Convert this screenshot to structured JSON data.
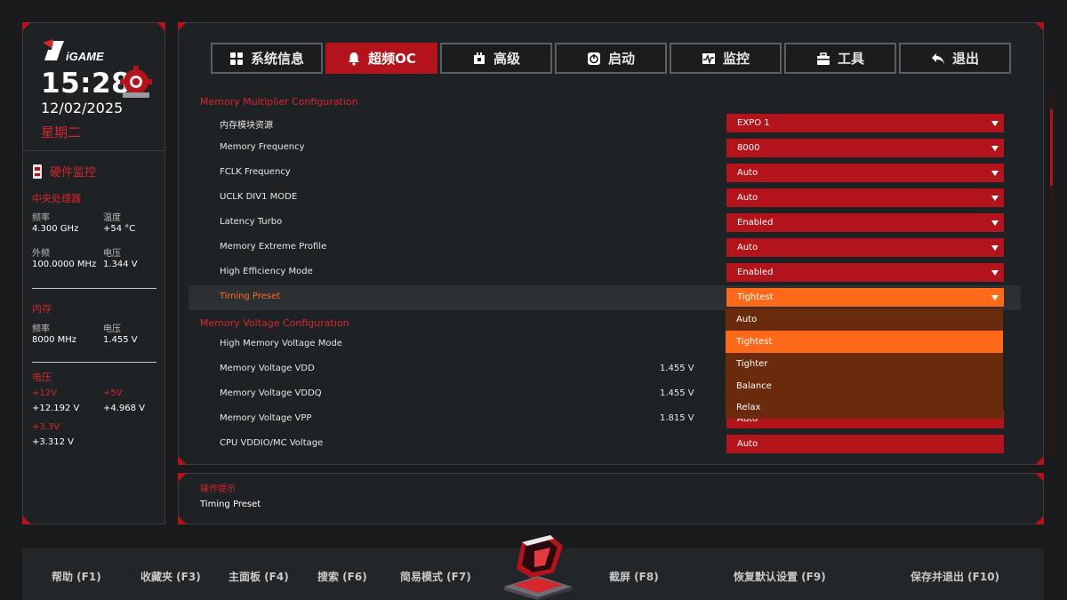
{
  "brand": {
    "logo_text": "iGAME",
    "accent": "#b3141b",
    "highlight": "#ff6a1a"
  },
  "sidebar": {
    "time": "15:28",
    "date": "12/02/2025",
    "weekday": "星期二",
    "hw_monitor_title": "硬件监控",
    "cpu": {
      "title": "中央处理器",
      "freq_label": "频率",
      "freq_value": "4.300 GHz",
      "temp_label": "温度",
      "temp_value": "+54 °C",
      "bclk_label": "外频",
      "bclk_value": "100.0000 MHz",
      "volt_label": "电压",
      "volt_value": "1.344 V"
    },
    "memory": {
      "title": "内存",
      "freq_label": "频率",
      "freq_value": "8000 MHz",
      "volt_label": "电压",
      "volt_value": "1.455 V"
    },
    "voltage": {
      "title": "电压",
      "v12_label": "+12V",
      "v12_value": "+12.192 V",
      "v5_label": "+5V",
      "v5_value": "+4.968 V",
      "v33_label": "+3.3V",
      "v33_value": "+3.312 V"
    }
  },
  "tabs": [
    {
      "label": "系统信息",
      "icon": "grid-icon"
    },
    {
      "label": "超频OC",
      "icon": "bell-icon",
      "active": true
    },
    {
      "label": "高级",
      "icon": "chip-icon"
    },
    {
      "label": "启动",
      "icon": "power-icon"
    },
    {
      "label": "监控",
      "icon": "pulse-icon"
    },
    {
      "label": "工具",
      "icon": "toolbox-icon"
    },
    {
      "label": "退出",
      "icon": "back-arrow-icon"
    }
  ],
  "groups": {
    "multiplier": "Memory Multiplier Configuration",
    "voltage": "Memory Voltage Configuration"
  },
  "settings": [
    {
      "label": "内存模块资源",
      "value": "EXPO 1"
    },
    {
      "label": "Memory Frequency",
      "value": "8000"
    },
    {
      "label": "FCLK Frequency",
      "value": "Auto"
    },
    {
      "label": "UCLK DIV1 MODE",
      "value": "Auto"
    },
    {
      "label": "Latency Turbo",
      "value": "Enabled"
    },
    {
      "label": "Memory Extreme Profile",
      "value": "Auto"
    },
    {
      "label": "High Efficiency Mode",
      "value": "Enabled"
    },
    {
      "label": "Timing Preset",
      "value": "Tightest"
    }
  ],
  "voltage_settings": [
    {
      "label": "High Memory Voltage Mode",
      "reading": "",
      "value": ""
    },
    {
      "label": "Memory Voltage VDD",
      "reading": "1.455 V",
      "value": ""
    },
    {
      "label": "Memory Voltage VDDQ",
      "reading": "1.455 V",
      "value": ""
    },
    {
      "label": "Memory Voltage VPP",
      "reading": "1.815 V",
      "value": "Auto"
    },
    {
      "label": "CPU VDDIO/MC Voltage",
      "reading": "",
      "value": "Auto"
    }
  ],
  "dropdown_options": [
    "Auto",
    "Tightest",
    "Tighter",
    "Balance",
    "Relax"
  ],
  "dropdown_selected": "Tightest",
  "hint": {
    "title": "操作提示",
    "text": "Timing Preset"
  },
  "footer": {
    "help": "帮助 (F1)",
    "favorites": "收藏夹 (F3)",
    "mainboard": "主面板 (F4)",
    "search": "搜索 (F6)",
    "easy_mode": "简易模式 (F7)",
    "screenshot": "截屏 (F8)",
    "restore": "恢复默认设置 (F9)",
    "save_exit": "保存并退出 (F10)"
  }
}
